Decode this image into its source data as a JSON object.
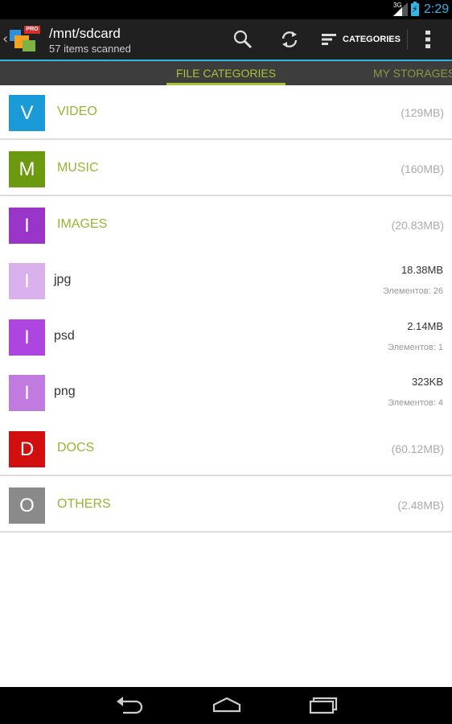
{
  "status_bar": {
    "network": "3G",
    "time": "2:29"
  },
  "action_bar": {
    "title": "/mnt/sdcard",
    "subtitle": "57 items scanned",
    "logo_badge": "PRO",
    "categories_label": "CATEGORIES",
    "icons": [
      "app-logo",
      "search-icon",
      "refresh-icon",
      "sort-icon",
      "overflow-menu-icon"
    ]
  },
  "tabs": [
    {
      "label": "FILE CATEGORIES",
      "active": true
    },
    {
      "label": "MY STORAGES",
      "active": false
    }
  ],
  "categories": [
    {
      "letter": "V",
      "name": "VIDEO",
      "size": "(129MB)",
      "color": "#1a9ad6",
      "kind": "category"
    },
    {
      "letter": "M",
      "name": "MUSIC",
      "size": "(160MB)",
      "color": "#6b9a10",
      "kind": "category"
    },
    {
      "letter": "I",
      "name": "IMAGES",
      "size": "(20.83MB)",
      "color": "#9a35c9",
      "kind": "category"
    },
    {
      "letter": "I",
      "name": "jpg",
      "size": "18.38MB",
      "count": "Элементов: 26",
      "color": "#d9b0ec",
      "kind": "sub"
    },
    {
      "letter": "I",
      "name": "psd",
      "size": "2.14MB",
      "count": "Элементов: 1",
      "color": "#ad45e0",
      "kind": "sub"
    },
    {
      "letter": "I",
      "name": "png",
      "size": "323KB",
      "count": "Элементов: 4",
      "color": "#c07ae0",
      "kind": "sub"
    },
    {
      "letter": "D",
      "name": "DOCS",
      "size": "(60.12MB)",
      "color": "#d10f0f",
      "kind": "category"
    },
    {
      "letter": "O",
      "name": "OTHERS",
      "size": "(2.48MB)",
      "color": "#8a8a8a",
      "kind": "category"
    }
  ],
  "colors": {
    "accent_blue": "#33b5e5",
    "tab_accent": "#a8c23a",
    "category_text": "#9bb335"
  }
}
